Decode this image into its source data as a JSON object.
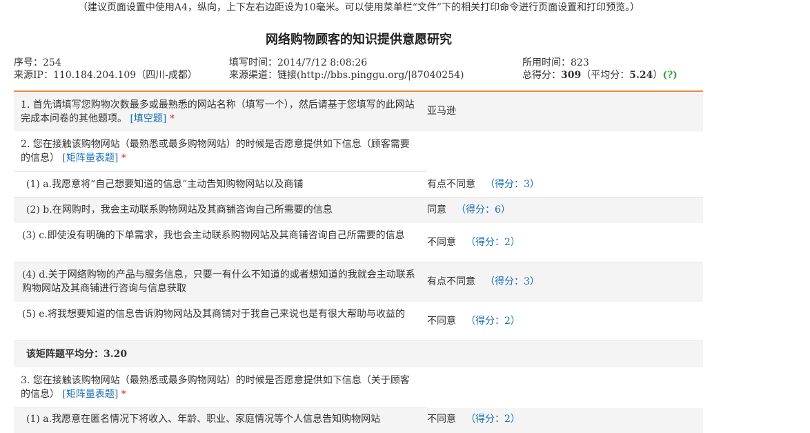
{
  "print_note": "（建议页面设置中使用A4，纵向，上下左右边距设为10毫米。可以使用菜单栏“文件”下的相关打印命令进行页面设置和打印预览。）",
  "survey_title": "网络购物顾客的知识提供意愿研究",
  "meta": {
    "serial_label": "序号：",
    "serial_value": "254",
    "ip_label": "来源IP：",
    "ip_value": "110.184.204.109（四川-成都）",
    "fill_time_label": "填写时间：",
    "fill_time_value": "2014/7/12 8:08:26",
    "channel_label": "来源渠道：",
    "channel_value": "链接(http://bbs.pinggu.org/|87040254)",
    "duration_label": "所用时间：",
    "duration_value": "823",
    "total_label": "总得分：",
    "total_value": "309",
    "avg_open": "（平均分：",
    "avg_value": "5.24",
    "avg_close": "）",
    "help": "(?)"
  },
  "questions": [
    {
      "text": "1. 首先请填写您购物次数最多或最熟悉的网站名称（填写一个），然后请基于您填写的此网站完成本问卷的其他题项。",
      "tag": "[填空题]",
      "required": "*",
      "answer": "亚马逊"
    },
    {
      "text": "2. 您在接触该购物网站（最熟悉或最多购物网站）的时候是否愿意提供如下信息（顾客需要的信息）",
      "tag": "[矩阵量表题]",
      "required": "*",
      "items": [
        {
          "text": "(1) a.我愿意将“自己想要知道的信息”主动告知购物网站以及商铺",
          "answer": "有点不同意",
          "score": "（得分：3）"
        },
        {
          "text": "(2) b.在网购时，我会主动联系购物网站及其商铺咨询自己所需要的信息",
          "answer": "同意",
          "score": "（得分：6）"
        },
        {
          "text": "(3) c.即使没有明确的下单需求，我也会主动联系购物网站及其商铺咨询自己所需要的信息",
          "answer": "不同意",
          "score": "（得分：2）"
        },
        {
          "text": "(4) d.关于网络购物的产品与服务信息，只要一有什么不知道的或者想知道的我就会主动联系购物网站及其商铺进行咨询与信息获取",
          "answer": "有点不同意",
          "score": "（得分：3）"
        },
        {
          "text": "(5) e.将我想要知道的信息告诉购物网站及其商铺对于我自己来说也是有很大帮助与收益的",
          "answer": "不同意",
          "score": "（得分：2）"
        }
      ],
      "matrix_avg": "该矩阵题平均分：3.20"
    },
    {
      "text": "3. 您在接触该购物网站（最熟悉或最多购物网站）的时候是否愿意提供如下信息（关于顾客的信息）",
      "tag": "[矩阵量表题]",
      "required": "*",
      "items": [
        {
          "text": "(1) a.我愿意在匿名情况下将收入、年龄、职业、家庭情况等个人信息告知购物网站",
          "answer": "不同意",
          "score": "（得分：2）"
        }
      ]
    }
  ],
  "colors": {
    "accent_line": "#f0883a",
    "link": "#1a6fb5",
    "required": "#e02020",
    "help": "#3aa53a",
    "row_grey": "#f4f4f4"
  }
}
